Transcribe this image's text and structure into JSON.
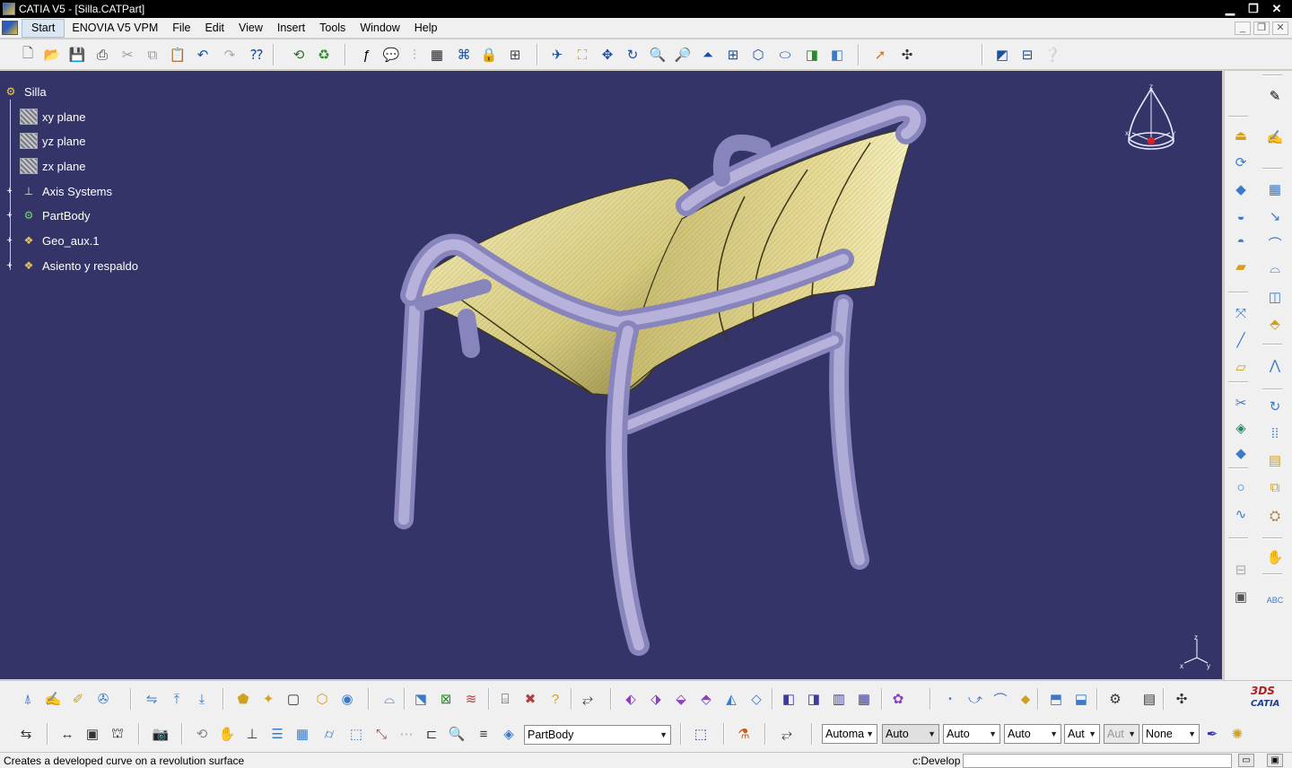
{
  "window": {
    "title": "CATIA V5 - [Silla.CATPart]"
  },
  "menu": {
    "items": [
      "Start",
      "ENOVIA V5 VPM",
      "File",
      "Edit",
      "View",
      "Insert",
      "Tools",
      "Window",
      "Help"
    ]
  },
  "tree": {
    "root": "Silla",
    "nodes": [
      "xy plane",
      "yz plane",
      "zx plane",
      "Axis Systems",
      "PartBody",
      "Geo_aux.1",
      "Asiento y respaldo"
    ]
  },
  "compass": {
    "x_label": "x",
    "y_label": "y",
    "z_label": "z"
  },
  "triad": {
    "x_label": "x",
    "y_label": "y",
    "z_label": "z"
  },
  "toolbar_bottom": {
    "current_body": "PartBody",
    "line_color": "Automa",
    "line_type": "Auto",
    "line_thickness": "Auto",
    "point_symbol": "Auto",
    "layer_a": "Aut",
    "layer_b": "Aut",
    "render_style": "None"
  },
  "logo": {
    "brand": "3DS",
    "product": "CATIA"
  },
  "status": {
    "message": "Creates a developed curve on a revolution surface",
    "environment": "c:Develop"
  },
  "colors": {
    "viewport_bg": "#343468",
    "tube": "#a8a4d4",
    "surface": "#f0e8a0"
  }
}
